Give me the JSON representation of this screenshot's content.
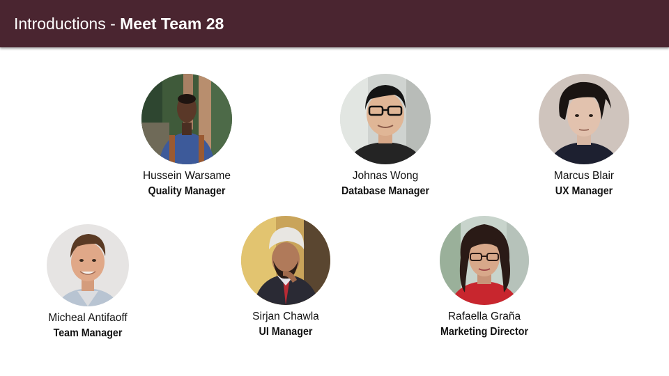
{
  "header": {
    "title_prefix": "Introductions - ",
    "title_bold": "Meet Team 28"
  },
  "members": [
    {
      "name": "Hussein Warsame",
      "role": "Quality Manager",
      "photo": "avatar"
    },
    {
      "name": "Johnas Wong",
      "role": "Database Manager",
      "photo": "avatar"
    },
    {
      "name": "Marcus Blair",
      "role": "UX Manager",
      "photo": "avatar"
    },
    {
      "name": "Micheal Antifaoff",
      "role": "Team Manager",
      "photo": "avatar"
    },
    {
      "name": "Sirjan Chawla",
      "role": "UI Manager",
      "photo": "avatar"
    },
    {
      "name": "Rafaella Graña",
      "role": "Marketing Director",
      "photo": "avatar"
    }
  ],
  "colors": {
    "header_bg": "#4a2530",
    "header_text": "#ffffff",
    "body_text": "#111111"
  }
}
